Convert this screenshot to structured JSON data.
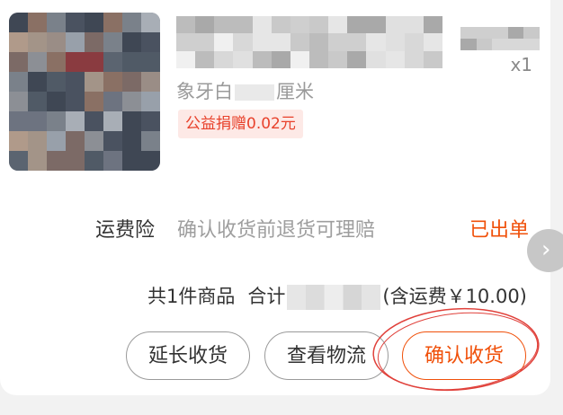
{
  "product": {
    "quantity": "x1",
    "spec_prefix": "象牙白",
    "spec_suffix": "厘米",
    "charity_tag": "公益捐赠0.02元"
  },
  "insurance": {
    "label": "运费险",
    "description": "确认收货前退货可理赔",
    "status": "已出单"
  },
  "summary": {
    "items": "共1件商品",
    "total_prefix": "合计",
    "total_suffix": "(含运费￥10.00)"
  },
  "actions": {
    "extend_label": "延长收货",
    "logistics_label": "查看物流",
    "confirm_label": "确认收货"
  },
  "colors": {
    "accent": "#f0500a",
    "charity_text": "#e8412b",
    "charity_bg": "#fde9e6",
    "annotation": "#e0403a"
  },
  "icons": {
    "scroll": "chevron-right-icon"
  }
}
